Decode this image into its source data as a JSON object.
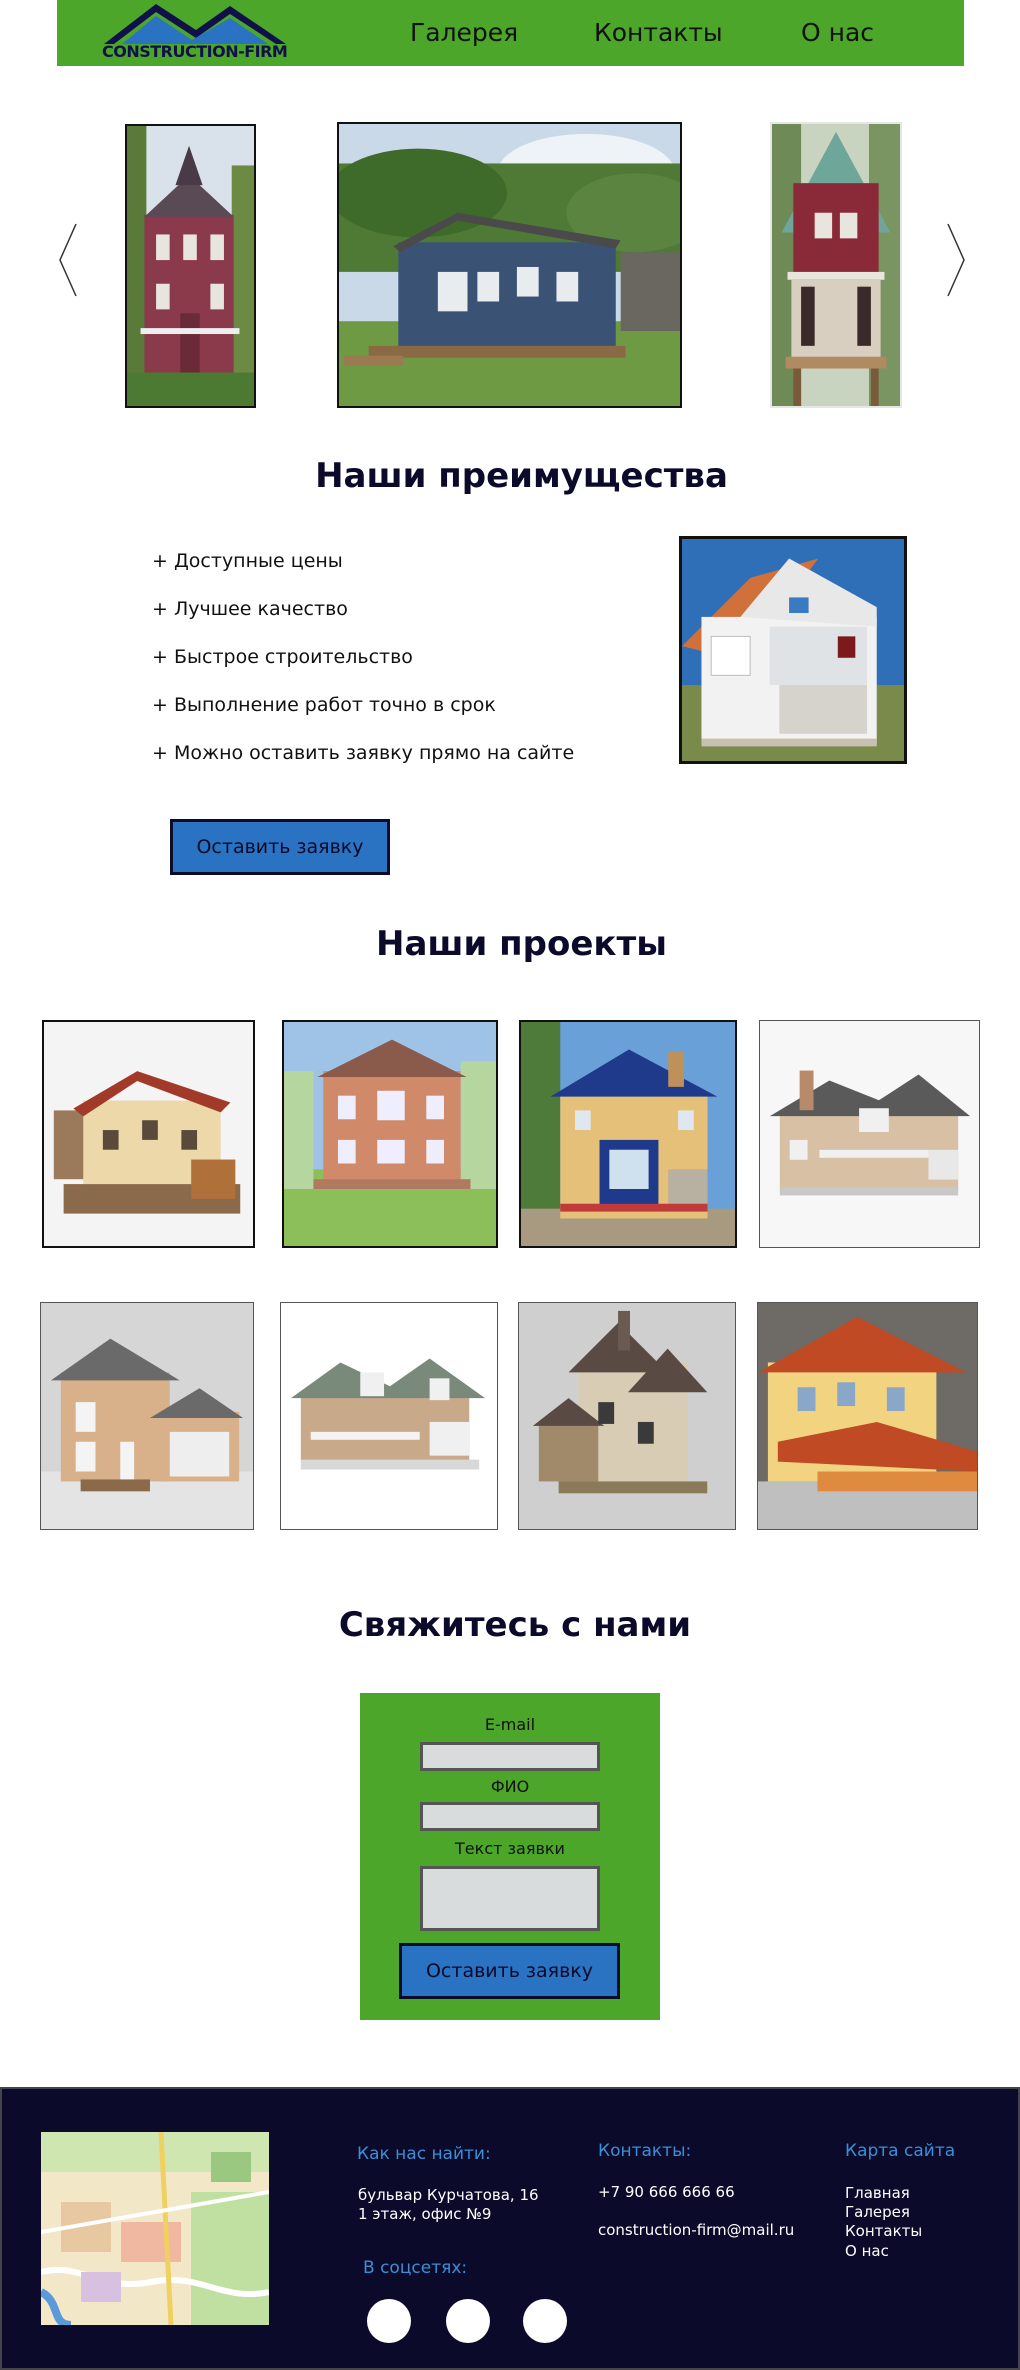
{
  "header": {
    "logo_text": "CONSTRUCTION-FIRM",
    "nav": [
      "Галерея",
      "Контакты",
      "О нас"
    ]
  },
  "advantages": {
    "title": "Наши преимущества",
    "items": [
      "+ Доступные цены",
      "+ Лучшее качество",
      "+ Быстрое строительство",
      "+ Выполнение работ точно в срок",
      "+ Можно оставить заявку прямо на сайте"
    ],
    "button": "Оставить заявку"
  },
  "projects": {
    "title": "Наши проекты"
  },
  "contact": {
    "title": "Свяжитесь с нами",
    "email_label": "E-mail",
    "name_label": "ФИО",
    "text_label": "Текст заявки",
    "button": "Оставить заявку"
  },
  "footer": {
    "find_title": "Как нас найти:",
    "address_1": "бульвар Курчатова, 16",
    "address_2": "1 этаж, офис №9",
    "social_title": "В соцсетях:",
    "contacts_title": "Контакты:",
    "phone": "+7 90 666 666 66",
    "email": "construction-firm@mail.ru",
    "sitemap_title": "Карта сайта",
    "sitemap": [
      "Главная",
      "Галерея",
      "Контакты",
      "О нас"
    ]
  },
  "colors": {
    "green": "#4ca629",
    "blue_button": "#2a72c2",
    "navy": "#0b0a2a",
    "footer_link": "#3b8fd6"
  },
  "icons": [
    "chevron-left-icon",
    "chevron-right-icon",
    "roof-logo-icon"
  ]
}
